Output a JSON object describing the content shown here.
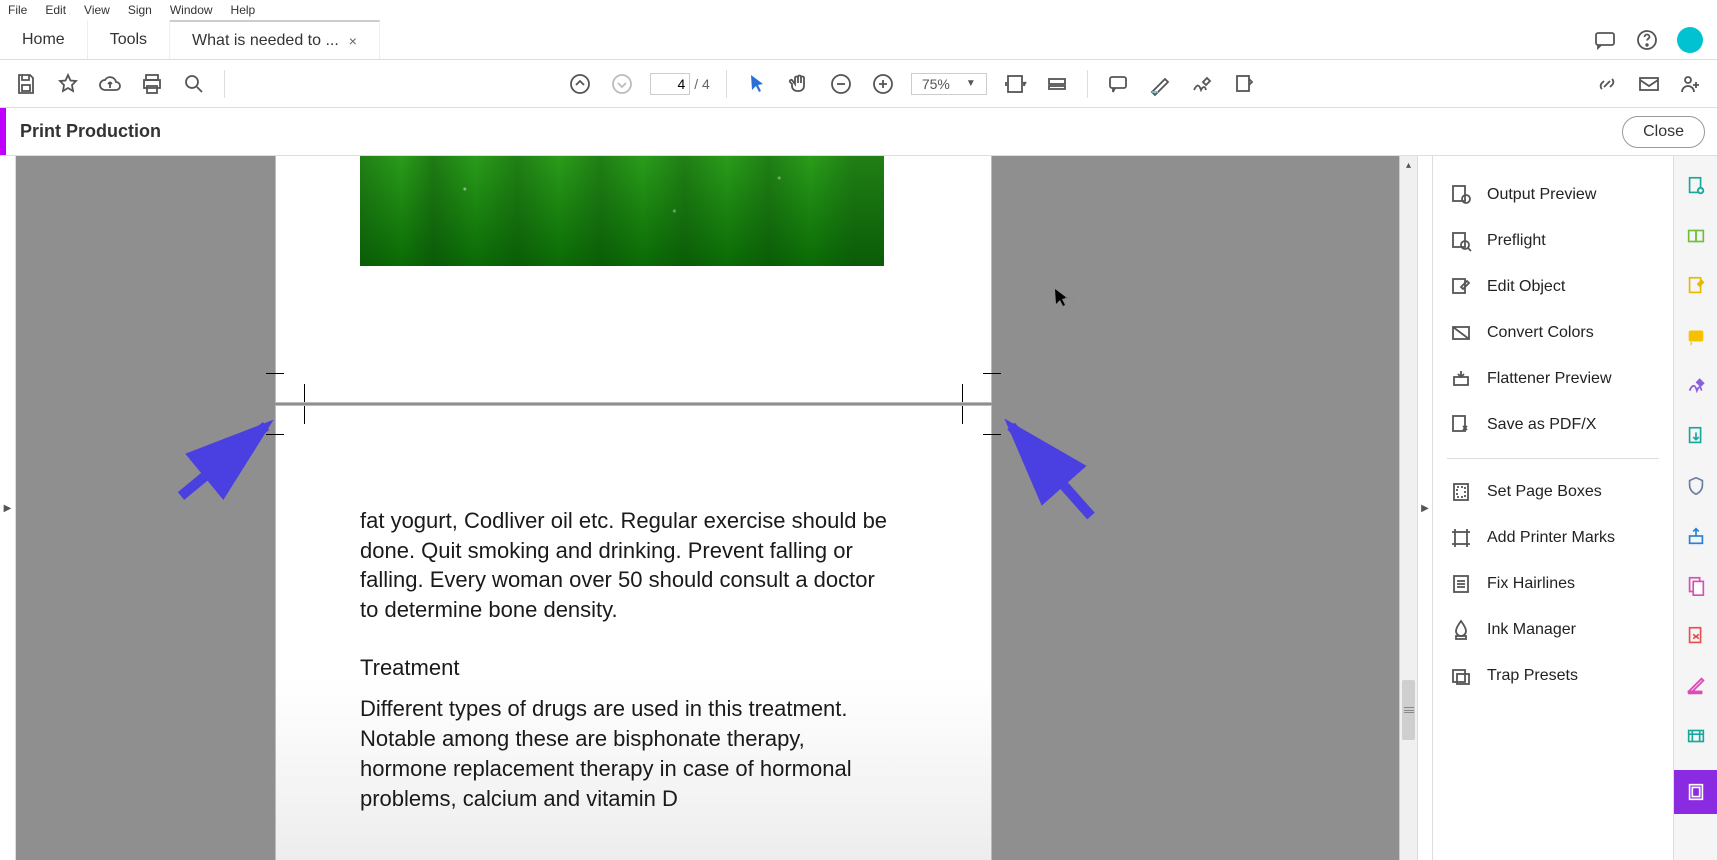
{
  "menubar": {
    "items": [
      "File",
      "Edit",
      "View",
      "Sign",
      "Window",
      "Help"
    ]
  },
  "tabs": {
    "home": "Home",
    "tools": "Tools",
    "doc": "What is needed to ..."
  },
  "toolbar": {
    "page_current": "4",
    "page_total": "/ 4",
    "zoom": "75%"
  },
  "panel": {
    "title": "Print Production",
    "close": "Close"
  },
  "document": {
    "para1": "fat yogurt, Codliver oil etc. Regular exercise should be done. Quit smoking and drinking. Prevent falling or falling. Every woman over 50 should consult a doctor to determine bone density.",
    "heading": "Treatment",
    "para2": "Different types of drugs are used in this treatment. Notable among these are bisphonate therapy, hormone replacement therapy in case of hormonal problems, calcium and vitamin D"
  },
  "sidebar": {
    "items1": [
      "Output Preview",
      "Preflight",
      "Edit Object",
      "Convert Colors",
      "Flattener Preview",
      "Save as PDF/X"
    ],
    "items2": [
      "Set Page Boxes",
      "Add Printer Marks",
      "Fix Hairlines",
      "Ink Manager",
      "Trap Presets"
    ]
  }
}
